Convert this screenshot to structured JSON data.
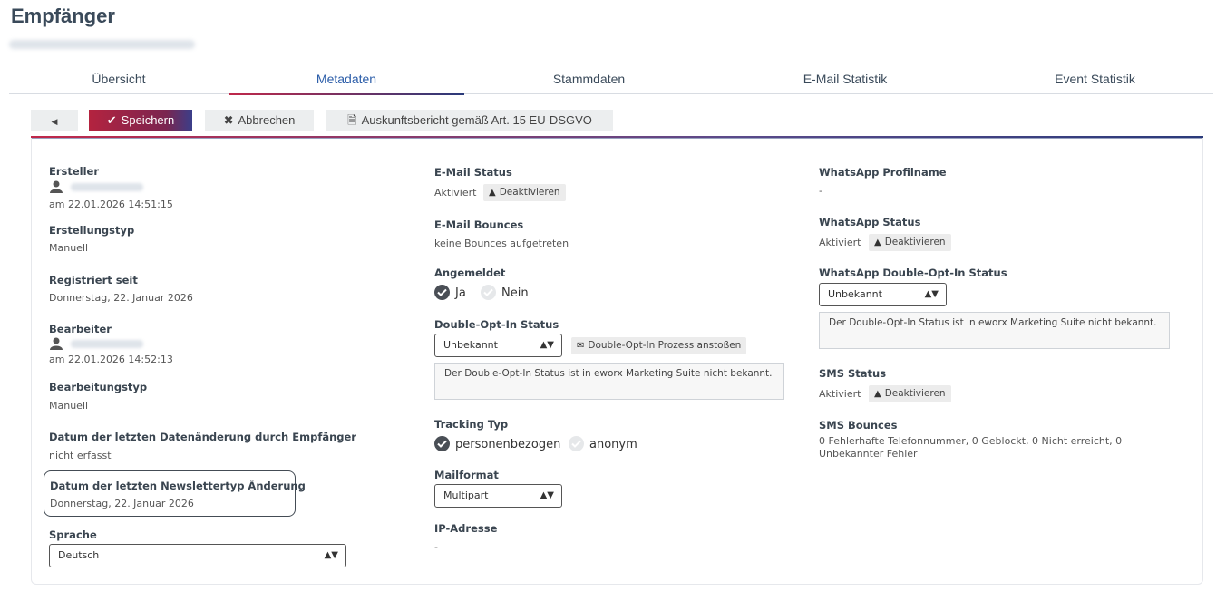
{
  "page": {
    "title": "Empfänger"
  },
  "tabs": [
    {
      "label": "Übersicht"
    },
    {
      "label": "Metadaten"
    },
    {
      "label": "Stammdaten"
    },
    {
      "label": "E-Mail Statistik"
    },
    {
      "label": "Event Statistik"
    }
  ],
  "active_tab": "Metadaten",
  "toolbar": {
    "save_label": "Speichern",
    "cancel_label": "Abbrechen",
    "report_label": "Auskunftsbericht gemäß Art. 15 EU-DSGVO"
  },
  "left": {
    "creator_label": "Ersteller",
    "creator_date": "am 22.01.2026 14:51:15",
    "creation_type_label": "Erstellungstyp",
    "creation_type_value": "Manuell",
    "registered_label": "Registriert seit",
    "registered_value": "Donnerstag, 22. Januar 2026",
    "editor_label": "Bearbeiter",
    "editor_date": "am 22.01.2026 14:52:13",
    "edit_type_label": "Bearbeitungstyp",
    "edit_type_value": "Manuell",
    "last_change_label": "Datum der letzten Datenänderung durch Empfänger",
    "last_change_value": "nicht erfasst",
    "newsletter_change_label": "Datum der letzten Newslettertyp Änderung",
    "newsletter_change_value": "Donnerstag, 22. Januar 2026",
    "language_label": "Sprache",
    "language_value": "Deutsch"
  },
  "middle": {
    "email_status_label": "E-Mail Status",
    "email_status_value": "Aktiviert",
    "deactivate_label": "Deaktivieren",
    "bounces_label": "E-Mail Bounces",
    "bounces_value": "keine Bounces aufgetreten",
    "subscribed_label": "Angemeldet",
    "subscribed_yes": "Ja",
    "subscribed_no": "Nein",
    "doi_label": "Double-Opt-In Status",
    "doi_value": "Unbekannt",
    "doi_button": "Double-Opt-In Prozess anstoßen",
    "doi_info": "Der Double-Opt-In Status ist in eworx Marketing Suite nicht bekannt.",
    "tracking_label": "Tracking Typ",
    "tracking_personal": "personenbezogen",
    "tracking_anon": "anonym",
    "mailformat_label": "Mailformat",
    "mailformat_value": "Multipart",
    "ip_label": "IP-Adresse",
    "ip_value": "-"
  },
  "right": {
    "wa_profile_label": "WhatsApp Profilname",
    "wa_profile_value": "-",
    "wa_status_label": "WhatsApp Status",
    "wa_status_value": "Aktiviert",
    "deactivate_label": "Deaktivieren",
    "wa_doi_label": "WhatsApp Double-Opt-In Status",
    "wa_doi_value": "Unbekannt",
    "wa_doi_info": "Der Double-Opt-In Status ist in eworx Marketing Suite nicht bekannt.",
    "sms_status_label": "SMS Status",
    "sms_status_value": "Aktiviert",
    "sms_bounces_label": "SMS Bounces",
    "sms_bounces_value": "0 Fehlerhafte Telefonnummer, 0 Geblockt, 0 Nicht erreicht, 0 Unbekannter Fehler"
  }
}
